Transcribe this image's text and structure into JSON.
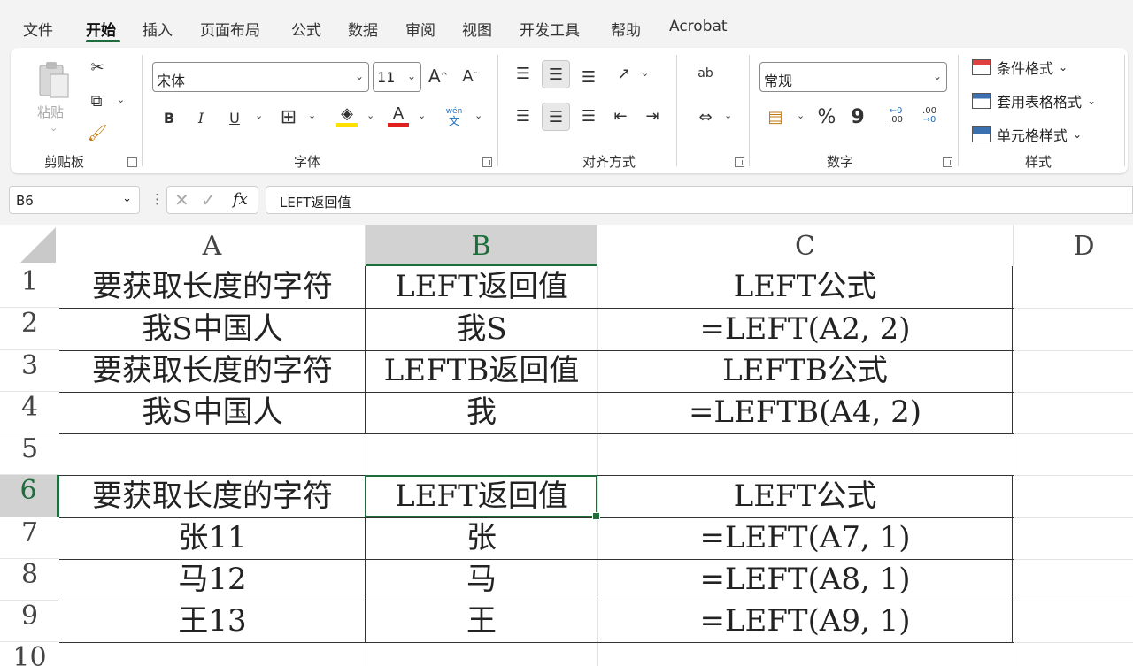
{
  "menu": [
    "文件",
    "开始",
    "插入",
    "页面布局",
    "公式",
    "数据",
    "审阅",
    "视图",
    "开发工具",
    "帮助",
    "Acrobat"
  ],
  "ribbon": {
    "clipboard": {
      "paste": "粘贴",
      "label": "剪贴板"
    },
    "font": {
      "name": "宋体",
      "size": "11",
      "bold": "B",
      "italic": "I",
      "underline": "U",
      "grow": "A",
      "shrink": "A",
      "font_color": "A",
      "phonetic_top": "wén",
      "phonetic_bottom": "文",
      "label": "字体"
    },
    "alignment": {
      "label": "对齐方式",
      "wrap": "ab"
    },
    "number": {
      "format": "常规",
      "percent": "%",
      "comma": "9",
      "inc_top": "←0",
      "inc_bottom": ".00",
      "dec_top": ".00",
      "dec_bottom": "→0",
      "label": "数字"
    },
    "styles": {
      "conditional": "条件格式",
      "table": "套用表格格式",
      "cell": "单元格样式",
      "label": "样式"
    }
  },
  "formula_bar": {
    "name_box": "B6",
    "fx": "fx",
    "content": "LEFT返回值"
  },
  "columns": [
    "A",
    "B",
    "C",
    "D"
  ],
  "rows": [
    "1",
    "2",
    "3",
    "4",
    "5",
    "6",
    "7",
    "8",
    "9",
    "10"
  ],
  "cells": [
    [
      "要获取长度的字符",
      "LEFT返回值",
      "LEFT公式"
    ],
    [
      "我S中国人",
      "我S",
      "=LEFT(A2, 2)"
    ],
    [
      "要获取长度的字符",
      "LEFTB返回值",
      "LEFTB公式"
    ],
    [
      "我S中国人",
      "我",
      "=LEFTB(A4, 2)"
    ],
    [
      "",
      "",
      ""
    ],
    [
      "要获取长度的字符",
      "LEFT返回值",
      "LEFT公式"
    ],
    [
      "张11",
      "张",
      "=LEFT(A7, 1)"
    ],
    [
      "马12",
      "马",
      "=LEFT(A8, 1)"
    ],
    [
      "王13",
      "王",
      "=LEFT(A9, 1)"
    ],
    [
      "",
      "",
      ""
    ]
  ],
  "colors": {
    "accent": "#1e6e3c",
    "highlight_yellow": "#ffe000",
    "font_red": "#e02020"
  }
}
